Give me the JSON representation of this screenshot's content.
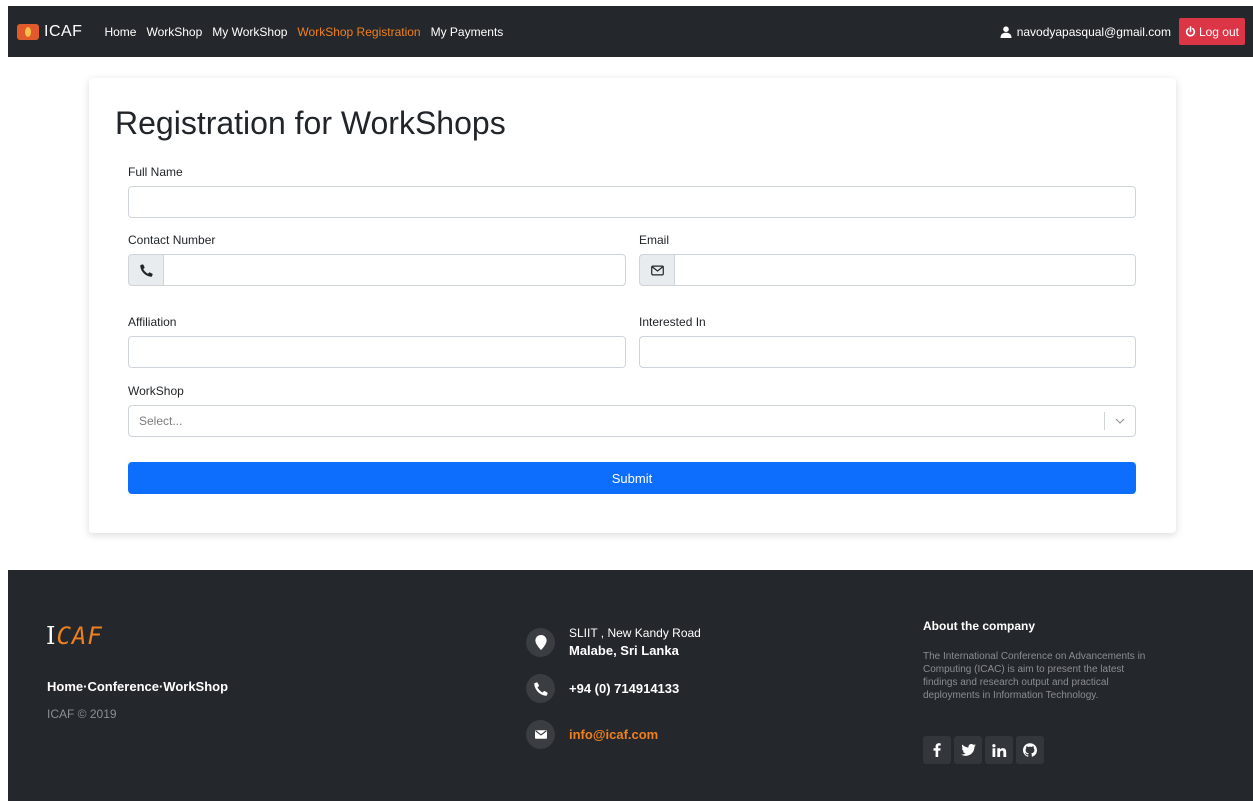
{
  "navbar": {
    "brand": "ICAF",
    "links": [
      {
        "label": "Home"
      },
      {
        "label": "WorkShop"
      },
      {
        "label": "My WorkShop"
      },
      {
        "label": "WorkShop Registration"
      },
      {
        "label": "My Payments"
      }
    ],
    "user_email": "navodyapasqual@gmail.com",
    "logout_label": "Log out"
  },
  "form": {
    "title": "Registration for WorkShops",
    "full_name": {
      "label": "Full Name",
      "value": ""
    },
    "contact": {
      "label": "Contact Number",
      "value": ""
    },
    "email": {
      "label": "Email",
      "value": ""
    },
    "affiliation": {
      "label": "Affiliation",
      "value": ""
    },
    "interested": {
      "label": "Interested In",
      "value": ""
    },
    "workshop": {
      "label": "WorkShop",
      "placeholder": "Select..."
    },
    "submit_label": "Submit"
  },
  "footer": {
    "logo_first": "I",
    "logo_rest": "CAF",
    "links": "Home·Conference·WorkShop",
    "copyright": "ICAF © 2019",
    "address_line1": "SLIIT , New Kandy Road",
    "address_line2": "Malabe, Sri Lanka",
    "phone": "+94 (0) 714914133",
    "email": "info@icaf.com",
    "about_title": "About the company",
    "about_text": "The International Conference on Advancements in Computing (ICAC) is aim to present the latest findings and research output and practical deployments in Information Technology.",
    "social": [
      {
        "icon": "facebook-icon",
        "glyph": "f"
      },
      {
        "icon": "twitter-icon",
        "glyph": "🐦"
      },
      {
        "icon": "linkedin-icon",
        "glyph": "in"
      },
      {
        "icon": "github-icon",
        "glyph": "◯"
      }
    ]
  },
  "colors": {
    "navbar_bg": "#24272b",
    "active_link": "#f0801e",
    "logout_bg": "#dc3545",
    "submit_bg": "#0d6efd",
    "footer_bg": "#24272b"
  }
}
